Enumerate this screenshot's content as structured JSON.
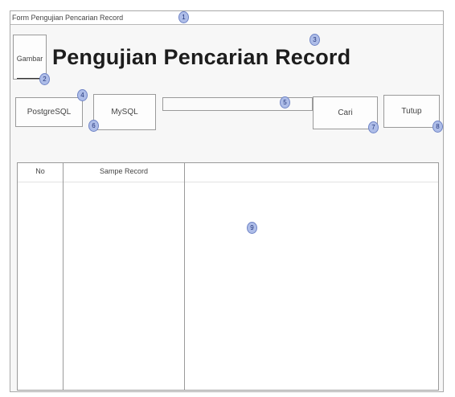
{
  "window": {
    "title": "Form Pengujian Pencarian Record"
  },
  "header": {
    "image_label": "Gambar",
    "title": "Pengujian Pencarian Record"
  },
  "toolbar": {
    "postgresql_label": "PostgreSQL",
    "mysql_label": "MySQL",
    "search_value": "",
    "search_label": "Cari",
    "close_label": "Tutup"
  },
  "table": {
    "columns": [
      "No",
      "Sampe Record",
      ""
    ]
  },
  "markers": [
    "1",
    "2",
    "3",
    "4",
    "5",
    "6",
    "7",
    "8",
    "9"
  ]
}
